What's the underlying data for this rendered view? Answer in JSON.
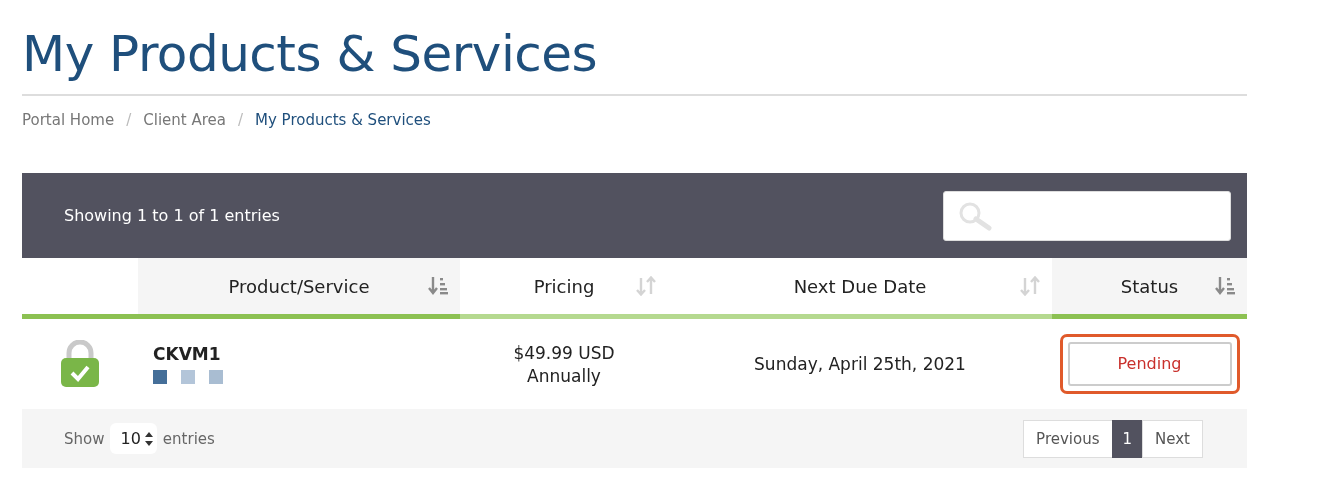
{
  "page_title": "My Products & Services",
  "breadcrumb_separator": "/",
  "breadcrumb": [
    {
      "label": "Portal Home",
      "current": false
    },
    {
      "label": "Client Area",
      "current": false
    },
    {
      "label": "My Products & Services",
      "current": true
    }
  ],
  "table": {
    "info": "Showing 1 to 1 of 1 entries",
    "has_search": true,
    "columns": [
      {
        "label": "Product/Service",
        "sorted": true
      },
      {
        "label": "Pricing",
        "sorted": false
      },
      {
        "label": "Next Due Date",
        "sorted": false
      },
      {
        "label": "Status",
        "sorted": true
      }
    ],
    "rows": [
      {
        "product": "CKVM1",
        "domain_redacted": true,
        "price": "$49.99 USD",
        "cycle": "Annually",
        "due": "Sunday, April 25th, 2021",
        "status": "Pending",
        "highlighted": true
      }
    ],
    "length": {
      "label_before": "Show",
      "value": "10",
      "label_after": "entries"
    },
    "pagination": [
      {
        "label": "Previous",
        "kind": "nav",
        "selected": false
      },
      {
        "label": "1",
        "kind": "page",
        "selected": true
      },
      {
        "label": "Next",
        "kind": "nav",
        "selected": false
      }
    ]
  }
}
